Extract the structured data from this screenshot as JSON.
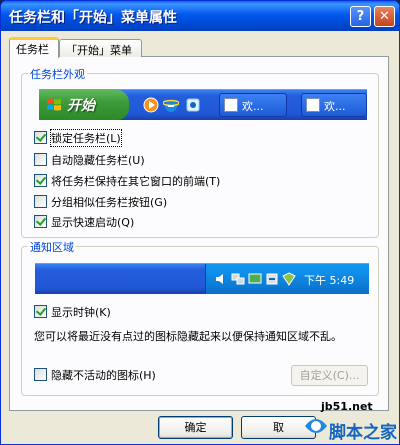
{
  "window": {
    "title": "任务栏和「开始」菜单属性"
  },
  "titlebar_buttons": {
    "help": "?",
    "close": "✕"
  },
  "tabs": [
    {
      "label": "任务栏",
      "active": true
    },
    {
      "label": "「开始」菜单",
      "active": false
    }
  ],
  "appearance_group": {
    "title": "任务栏外观",
    "preview": {
      "start_label": "开始",
      "quick_launch_icons": [
        "media-player-icon",
        "ie-icon",
        "outlook-icon"
      ],
      "task_buttons": [
        "欢...",
        "欢..."
      ]
    },
    "options": [
      {
        "label": "锁定任务栏(L)",
        "checked": true
      },
      {
        "label": "自动隐藏任务栏(U)",
        "checked": false
      },
      {
        "label": "将任务栏保持在其它窗口的前端(T)",
        "checked": true
      },
      {
        "label": "分组相似任务栏按钮(G)",
        "checked": false
      },
      {
        "label": "显示快速启动(Q)",
        "checked": true
      }
    ]
  },
  "notification_group": {
    "title": "通知区域",
    "tray": {
      "time": "下午 5:49"
    },
    "show_clock": {
      "label": "显示时钟(K)",
      "checked": true
    },
    "description": "您可以将最近没有点过的图标隐藏起来以便保持通知区域不乱。",
    "hide_inactive": {
      "label": "隐藏不活动的图标(H)",
      "checked": false
    },
    "customize_label": "自定义(C)..."
  },
  "buttons": {
    "ok": "确定",
    "cancel": "取"
  },
  "watermark": {
    "site": "jb51.net",
    "text": "脚本之家"
  },
  "colors": {
    "accent": "#0046d5",
    "titlebar": "#0058ee",
    "taskbar": "#245edb",
    "start": "#3c9b38"
  }
}
